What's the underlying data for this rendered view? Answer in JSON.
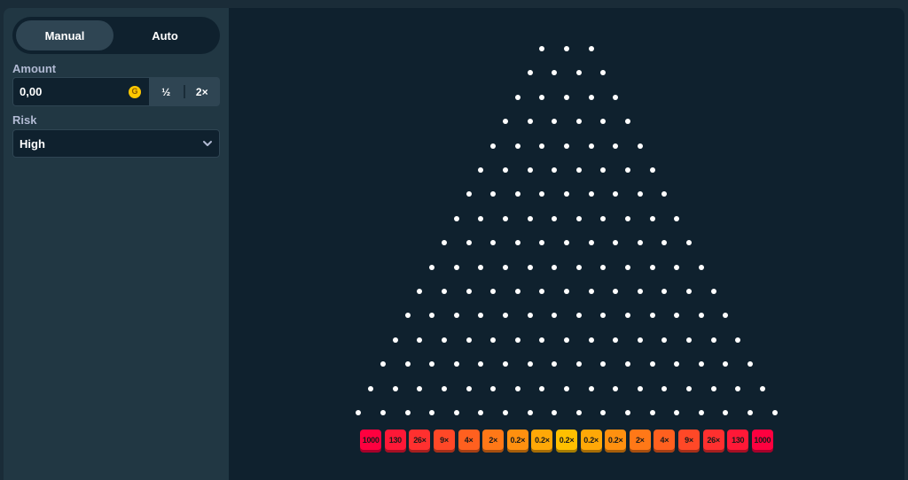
{
  "sidebar": {
    "tabs": [
      {
        "label": "Manual",
        "active": true
      },
      {
        "label": "Auto",
        "active": false
      }
    ],
    "amount": {
      "label": "Amount",
      "value": "0,00",
      "currency_icon": "coin-icon",
      "currency_glyph": "G",
      "half_label": "½",
      "double_label": "2×"
    },
    "risk": {
      "label": "Risk",
      "value": "High",
      "chevron_icon": "chevron-down-icon"
    }
  },
  "board": {
    "rows": 16,
    "peg_color": "#ffffff",
    "buckets": [
      {
        "label": "1000",
        "color": "#ff003f",
        "shadow": "#a6002a"
      },
      {
        "label": "130",
        "color": "#ff1837",
        "shadow": "#a60f24"
      },
      {
        "label": "26×",
        "color": "#ff302f",
        "shadow": "#a61f1f"
      },
      {
        "label": "9×",
        "color": "#ff4827",
        "shadow": "#a62f19"
      },
      {
        "label": "4×",
        "color": "#ff601f",
        "shadow": "#a63f14"
      },
      {
        "label": "2×",
        "color": "#ff7817",
        "shadow": "#a64e0f"
      },
      {
        "label": "0.2×",
        "color": "#ff900f",
        "shadow": "#a65e0a"
      },
      {
        "label": "0.2×",
        "color": "#ffa807",
        "shadow": "#a66d05"
      },
      {
        "label": "0.2×",
        "color": "#ffc000",
        "shadow": "#a67d00"
      },
      {
        "label": "0.2×",
        "color": "#ffa807",
        "shadow": "#a66d05"
      },
      {
        "label": "0.2×",
        "color": "#ff900f",
        "shadow": "#a65e0a"
      },
      {
        "label": "2×",
        "color": "#ff7817",
        "shadow": "#a64e0f"
      },
      {
        "label": "4×",
        "color": "#ff601f",
        "shadow": "#a63f14"
      },
      {
        "label": "9×",
        "color": "#ff4827",
        "shadow": "#a62f19"
      },
      {
        "label": "26×",
        "color": "#ff302f",
        "shadow": "#a61f1f"
      },
      {
        "label": "130",
        "color": "#ff1837",
        "shadow": "#a60f24"
      },
      {
        "label": "1000",
        "color": "#ff003f",
        "shadow": "#a6002a"
      }
    ]
  }
}
